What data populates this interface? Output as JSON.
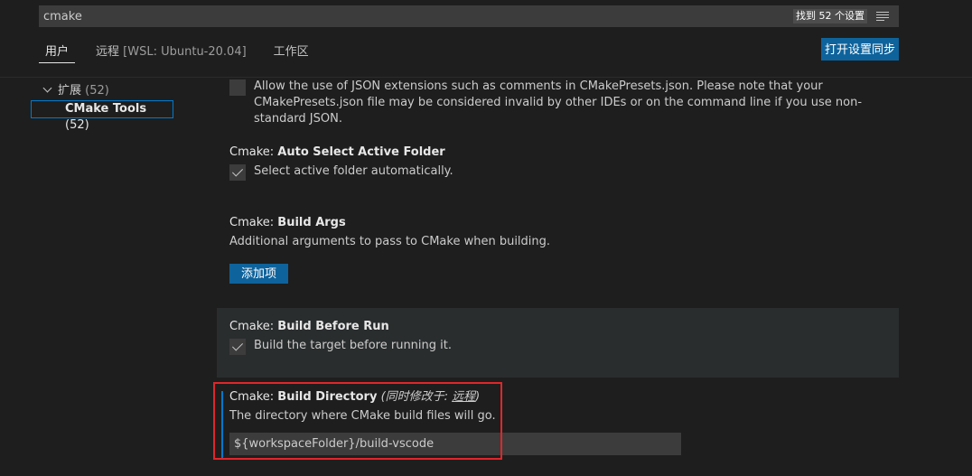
{
  "search": {
    "value": "cmake",
    "result_count": "找到 52 个设置"
  },
  "tabs": [
    {
      "label": "用户"
    },
    {
      "label_main": "远程",
      "label_dim": "[WSL: Ubuntu-20.04]"
    },
    {
      "label": "工作区"
    }
  ],
  "sync_button": "打开设置同步",
  "toc": {
    "group_label": "扩展",
    "group_count": "(52)",
    "item_label": "CMake Tools",
    "item_count": "(52)"
  },
  "settings": {
    "json_ext": {
      "description": "Allow the use of JSON extensions such as comments in CMakePresets.json. Please note that your CMakePresets.json file may be considered invalid by other IDEs or on the command line if you use non-standard JSON.",
      "checked": false
    },
    "auto_select": {
      "category": "Cmake: ",
      "key": "Auto Select Active Folder",
      "checkbox_label": "Select active folder automatically.",
      "checked": true
    },
    "build_args": {
      "category": "Cmake: ",
      "key": "Build Args",
      "description": "Additional arguments to pass to CMake when building.",
      "button": "添加项"
    },
    "build_before_run": {
      "category": "Cmake: ",
      "key": "Build Before Run",
      "checkbox_label": "Build the target before running it.",
      "checked": true
    },
    "build_directory": {
      "category": "Cmake: ",
      "key": "Build Directory",
      "also_modified": "(同时修改于: ",
      "also_modified_link": "远程",
      "also_modified_close": ")",
      "description": "The directory where CMake build files will go.",
      "value": "${workspaceFolder}/build-vscode"
    }
  },
  "colors": {
    "accent": "#007acc",
    "button": "#0e639c",
    "highlight": "#e0262b"
  }
}
